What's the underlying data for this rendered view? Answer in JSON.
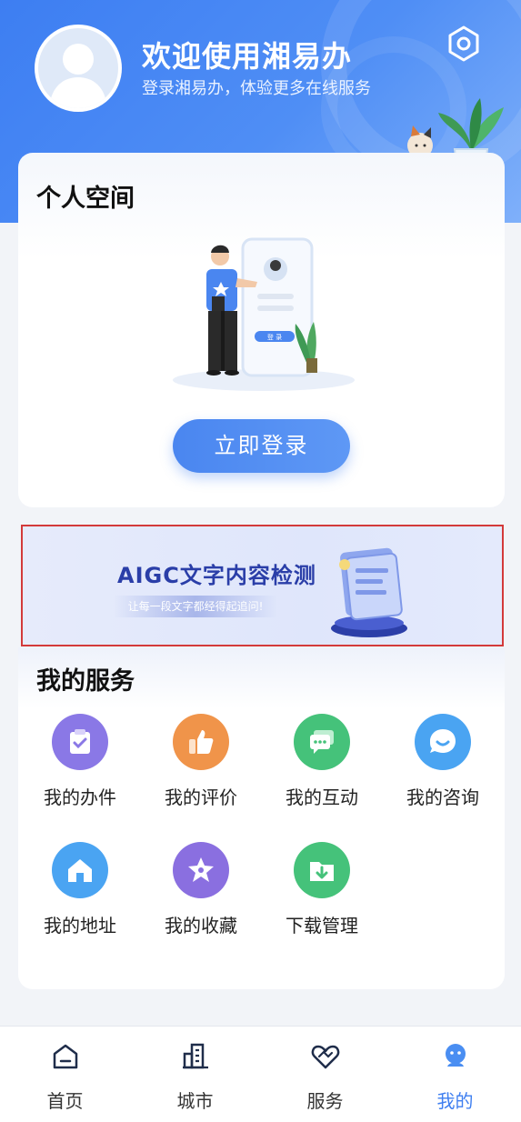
{
  "header": {
    "title": "欢迎使用湘易办",
    "subtitle": "登录湘易办，体验更多在线服务"
  },
  "personal": {
    "title": "个人空间",
    "login_button": "立即登录",
    "illustration_button_text": "登 录"
  },
  "banner": {
    "title": "AIGC文字内容检测",
    "subtitle": "让每一段文字都经得起追问!"
  },
  "services": {
    "title": "我的服务",
    "items": [
      {
        "label": "我的办件",
        "icon": "clipboard-check-icon",
        "color": "#8a78e6"
      },
      {
        "label": "我的评价",
        "icon": "thumbs-up-icon",
        "color": "#f0944a"
      },
      {
        "label": "我的互动",
        "icon": "chat-bubbles-icon",
        "color": "#45c27a"
      },
      {
        "label": "我的咨询",
        "icon": "smile-chat-icon",
        "color": "#4aa4f2"
      },
      {
        "label": "我的地址",
        "icon": "home-icon",
        "color": "#4aa4f2"
      },
      {
        "label": "我的收藏",
        "icon": "star-icon",
        "color": "#8a6fe0"
      },
      {
        "label": "下载管理",
        "icon": "download-folder-icon",
        "color": "#45c27a"
      }
    ]
  },
  "tabbar": {
    "items": [
      {
        "label": "首页",
        "icon": "home-outline-icon",
        "active": false
      },
      {
        "label": "城市",
        "icon": "buildings-icon",
        "active": false
      },
      {
        "label": "服务",
        "icon": "heart-handshake-icon",
        "active": false
      },
      {
        "label": "我的",
        "icon": "profile-icon",
        "active": true
      }
    ],
    "active_color": "#3f7ff0"
  }
}
